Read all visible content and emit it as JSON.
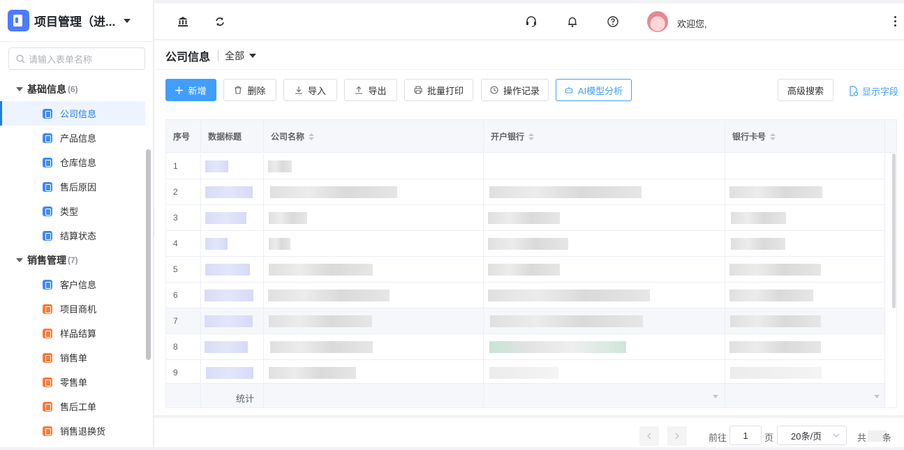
{
  "app": {
    "title": "项目管理（进..."
  },
  "search": {
    "placeholder": "请输入表单名称"
  },
  "sidebar": {
    "groups": [
      {
        "label": "基础信息",
        "count": "(6)",
        "items": [
          {
            "label": "公司信息",
            "color": "blue",
            "active": true
          },
          {
            "label": "产品信息",
            "color": "blue"
          },
          {
            "label": "仓库信息",
            "color": "blue"
          },
          {
            "label": "售后原因",
            "color": "blue"
          },
          {
            "label": "类型",
            "color": "blue"
          },
          {
            "label": "结算状态",
            "color": "blue"
          }
        ]
      },
      {
        "label": "销售管理",
        "count": "(7)",
        "items": [
          {
            "label": "客户信息",
            "color": "blue"
          },
          {
            "label": "项目商机",
            "color": "orange"
          },
          {
            "label": "样品结算",
            "color": "orange"
          },
          {
            "label": "销售单",
            "color": "orange"
          },
          {
            "label": "零售单",
            "color": "orange"
          },
          {
            "label": "售后工单",
            "color": "orange"
          },
          {
            "label": "销售退换货",
            "color": "orange"
          }
        ]
      }
    ]
  },
  "topbar": {
    "welcome": "欢迎您,"
  },
  "page": {
    "title": "公司信息",
    "scope": "全部"
  },
  "toolbar": {
    "add": "新增",
    "delete": "删除",
    "import": "导入",
    "export": "导出",
    "print": "批量打印",
    "log": "操作记录",
    "ai": "AI模型分析",
    "advanced_search": "高级搜索",
    "show_fields": "显示字段"
  },
  "table": {
    "columns": [
      "序号",
      "数据标题",
      "公司名称",
      "开户银行",
      "银行卡号"
    ],
    "rows": [
      "1",
      "2",
      "3",
      "4",
      "5",
      "6",
      "7",
      "8",
      "9"
    ],
    "footer_label": "统计"
  },
  "pagination": {
    "goto_label": "前往",
    "page_value": "1",
    "page_unit": "页",
    "page_size": "20条/页",
    "total_prefix": "共",
    "total_suffix": "条"
  },
  "colors": {
    "primary": "#409eff",
    "active_text": "#1e7ee6",
    "icon_blue": "#3d8bfa",
    "icon_orange": "#ff7a36"
  }
}
